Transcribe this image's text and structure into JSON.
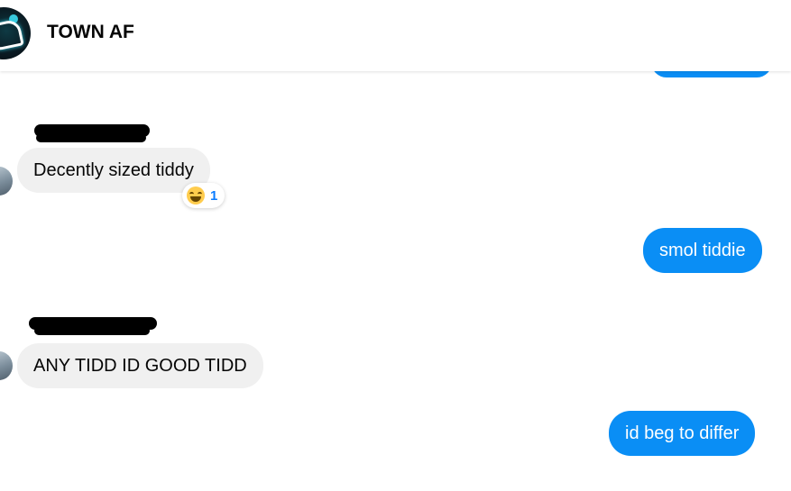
{
  "header": {
    "title": "TOWN AF"
  },
  "messages": [
    {
      "direction": "incoming",
      "text": "Decently sized tiddy",
      "reaction": {
        "emoji": "grinning-squinting-face",
        "count": "1"
      }
    },
    {
      "direction": "outgoing",
      "text": "smol tiddie"
    },
    {
      "direction": "incoming",
      "text": "ANY TIDD ID GOOD TIDD"
    },
    {
      "direction": "outgoing",
      "text": "id beg to differ"
    }
  ],
  "colors": {
    "outgoing_bubble": "#0a8ef5",
    "incoming_bubble": "#f0f0f0",
    "reaction_count": "#0a7cff"
  }
}
